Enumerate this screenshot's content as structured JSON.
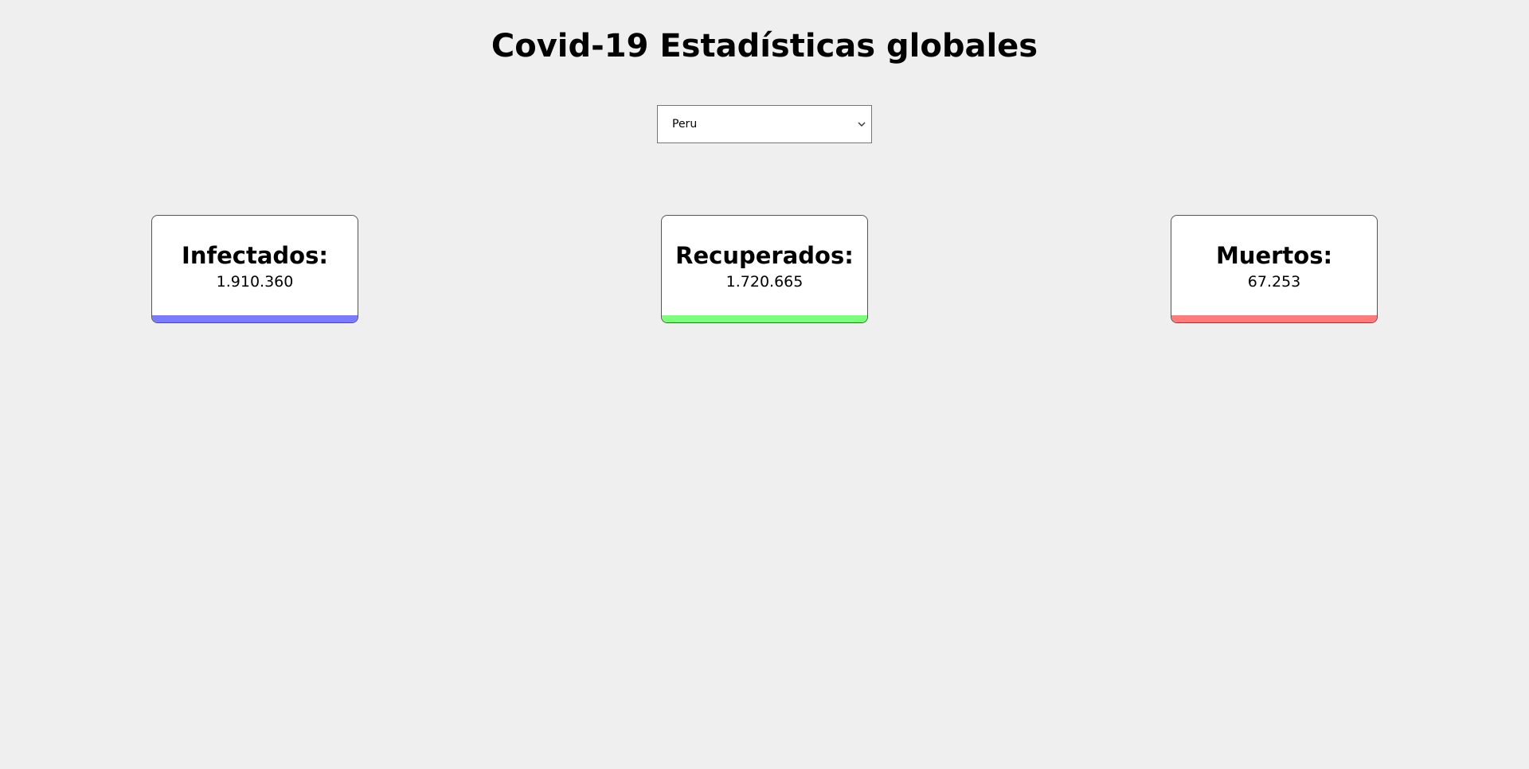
{
  "header": {
    "title": "Covid-19 Estadísticas globales"
  },
  "country_select": {
    "selected": "Peru",
    "icon": "chevron-down-icon"
  },
  "stats": {
    "infected": {
      "label": "Infectados:",
      "value": "1.910.360",
      "color": "#7b7bff"
    },
    "recovered": {
      "label": "Recuperados:",
      "value": "1.720.665",
      "color": "#7bff7b"
    },
    "deaths": {
      "label": "Muertos:",
      "value": "67.253",
      "color": "#ff7b7b"
    }
  }
}
